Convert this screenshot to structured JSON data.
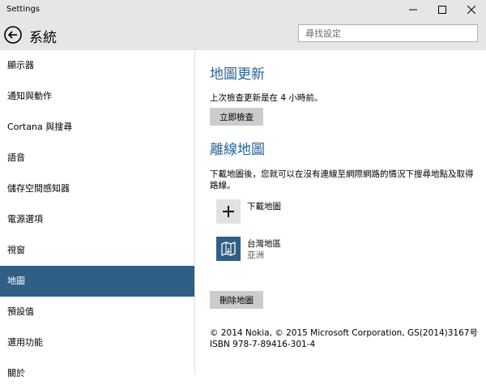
{
  "window": {
    "title": "Settings",
    "minimize_icon": "minimize-icon",
    "maximize_icon": "maximize-icon",
    "close_icon": "close-icon"
  },
  "header": {
    "back_icon": "back-arrow-icon",
    "title": "系統",
    "search_placeholder": "尋找設定"
  },
  "sidebar": {
    "items": [
      {
        "label": "顯示器",
        "selected": false
      },
      {
        "label": "通知與動作",
        "selected": false
      },
      {
        "label": "Cortana 與搜尋",
        "selected": false
      },
      {
        "label": "語音",
        "selected": false
      },
      {
        "label": "儲存空間感知器",
        "selected": false
      },
      {
        "label": "電源選項",
        "selected": false
      },
      {
        "label": "視窗",
        "selected": false
      },
      {
        "label": "地圖",
        "selected": true
      },
      {
        "label": "預設值",
        "selected": false
      },
      {
        "label": "選用功能",
        "selected": false
      },
      {
        "label": "關於",
        "selected": false
      }
    ]
  },
  "main": {
    "map_updates": {
      "heading": "地圖更新",
      "last_checked": "上次檢查更新是在 4 小時前。",
      "check_button": "立即檢查"
    },
    "offline_maps": {
      "heading": "離線地圖",
      "description": "下載地圖後，您就可以在沒有連線至網際網路的情況下搜尋地點及取得路線。",
      "download": {
        "label": "下載地圖",
        "icon": "plus-icon"
      },
      "maps": [
        {
          "name": "台灣地區",
          "region": "亚洲",
          "icon": "map-icon"
        }
      ],
      "delete_button": "刪除地圖"
    },
    "copyright": {
      "line1": "© 2014 Nokia, © 2015 Microsoft Corporation, GS(2014)3167号",
      "line2": "ISBN 978-7-89416-301-4"
    }
  },
  "colors": {
    "accent": "#2f5f85",
    "heading": "#2b6395",
    "chrome": "#e6e6e6",
    "button": "#cccccc"
  }
}
